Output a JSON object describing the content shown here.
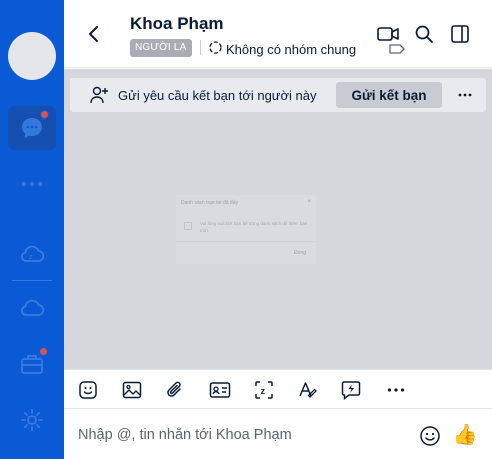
{
  "sidebar": {
    "items": [
      {
        "name": "avatar"
      },
      {
        "name": "messages-icon",
        "active": true
      },
      {
        "name": "more-icon"
      },
      {
        "name": "zcloud-icon"
      },
      {
        "name": "cloud-icon"
      },
      {
        "name": "briefcase-icon"
      },
      {
        "name": "settings-icon"
      }
    ],
    "accent_color": "#0a5ad6"
  },
  "header": {
    "contact_name": "Khoa Phạm",
    "stranger_tag": "NGƯỜI LẠ",
    "groups_text": "Không có nhóm chung",
    "icons": [
      "back-icon",
      "video-call-icon",
      "search-icon",
      "toggle-panel-icon",
      "label-tag-icon"
    ]
  },
  "friend_request_bar": {
    "text": "Gửi yêu cầu kết bạn tới người này",
    "button_label": "Gửi kết bạn",
    "more_label": "···"
  },
  "faded_dialog": {
    "title": "Danh sách bạn bè đã đầy",
    "close": "×",
    "message": "Vui lòng xoá bớt bạn bè trong danh sách để thêm bạn mới.",
    "button": "Đóng"
  },
  "toolbar": {
    "icons": [
      "sticker-icon",
      "image-icon",
      "attach-icon",
      "contact-card-icon",
      "screenshot-icon",
      "format-text-icon",
      "quick-message-icon",
      "more-options-icon"
    ],
    "more_label": "···"
  },
  "composer": {
    "placeholder": "Nhập @, tin nhắn tới Khoa Phạm",
    "value": "",
    "like_emoji": "👍"
  }
}
